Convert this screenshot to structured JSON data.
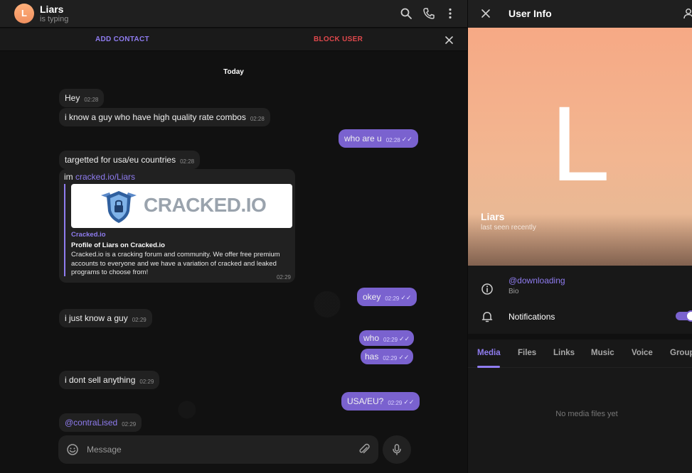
{
  "chat": {
    "avatar_letter": "L",
    "name": "Liars",
    "status": "is typing",
    "actions": {
      "add_contact": "ADD CONTACT",
      "block_user": "BLOCK USER"
    },
    "date_chip": "Today",
    "messages": [
      {
        "text": "Hey",
        "time": "02:28",
        "dir": "in"
      },
      {
        "text": "i know a guy who have high quality rate combos",
        "time": "02:28",
        "dir": "in"
      },
      {
        "text": "who are u",
        "time": "02:28",
        "dir": "out"
      },
      {
        "text": "targetted for usa/eu countries",
        "time": "02:28",
        "dir": "in"
      },
      {
        "text": "okey",
        "time": "02:29",
        "dir": "out"
      },
      {
        "text": "i just know a guy",
        "time": "02:29",
        "dir": "in"
      },
      {
        "text": "who",
        "time": "02:29",
        "dir": "out"
      },
      {
        "text": "has",
        "time": "02:29",
        "dir": "out"
      },
      {
        "text": "i dont sell anything",
        "time": "02:29",
        "dir": "in"
      },
      {
        "text": "USA/EU?",
        "time": "02:29",
        "dir": "out"
      },
      {
        "text": "@contraLised",
        "time": "02:29",
        "dir": "in"
      }
    ],
    "link_message": {
      "prefix": "im ",
      "link": "cracked.io/Liars",
      "preview_logo": "CRACKED.IO",
      "site": "Cracked.io",
      "title": "Profile of Liars on Cracked.io",
      "description": "Cracked.io is a cracking forum and community. We offer free premium accounts to everyone and we have a variation of cracked and leaked programs to choose from!",
      "time": "02:29"
    },
    "composer_placeholder": "Message",
    "ticks": "✓✓"
  },
  "info": {
    "title": "User Info",
    "cover_letter": "L",
    "name": "Liars",
    "last_seen": "last seen recently",
    "username": "@downloading",
    "bio_label": "Bio",
    "notifications_label": "Notifications",
    "notifications_on": true,
    "tabs": [
      "Media",
      "Files",
      "Links",
      "Music",
      "Voice",
      "Group"
    ],
    "active_tab": "Media",
    "empty_text": "No media files yet"
  },
  "colors": {
    "accent": "#8f7cf0",
    "outgoing": "#7a62cf",
    "block": "#e0484c",
    "incoming": "#212121"
  }
}
